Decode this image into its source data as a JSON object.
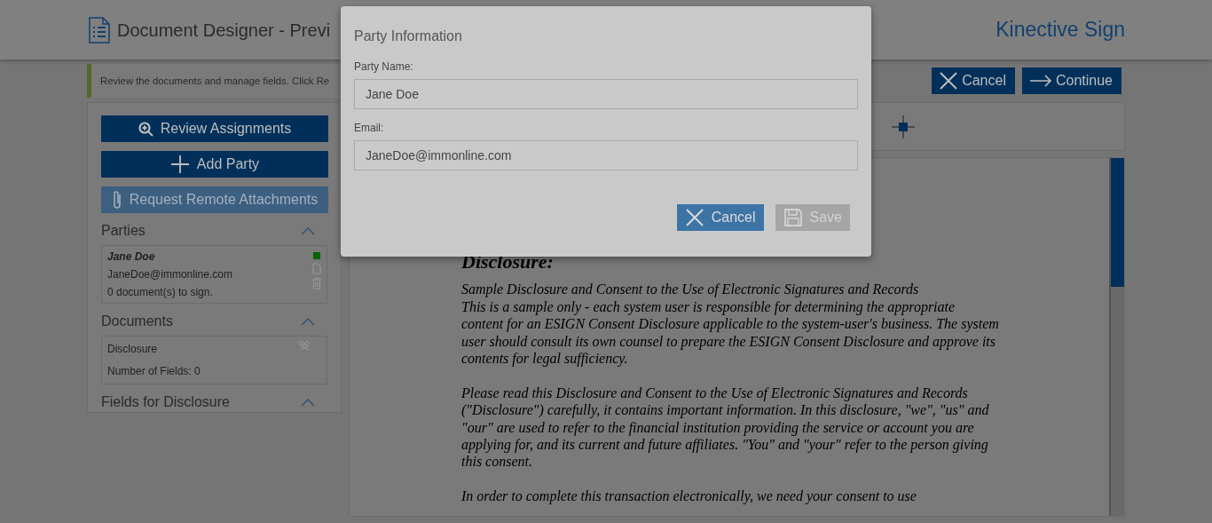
{
  "header": {
    "title": "Document Designer - Previ",
    "brand": "Kinective Sign"
  },
  "instruction": "Review the documents and manage fields. Click Re",
  "actions": [
    {
      "label": "Cancel"
    },
    {
      "label": "Continue"
    }
  ],
  "sidebar": {
    "buttons": [
      {
        "label": "Review Assignments",
        "disabled": false
      },
      {
        "label": "Add Party",
        "disabled": false
      },
      {
        "label": "Request Remote Attachments",
        "disabled": true
      }
    ],
    "sections": [
      {
        "title": "Parties",
        "expanded": true,
        "kind": "parties",
        "items": [
          {
            "name": "Jane Doe",
            "email": "JaneDoe@immonline.com",
            "note": "0 document(s) to sign.",
            "color": "#006400"
          }
        ]
      },
      {
        "title": "Documents",
        "expanded": true,
        "kind": "documents",
        "items": [
          {
            "name": "Disclosure",
            "note": "Number of Fields: 0"
          }
        ]
      },
      {
        "title": "Fields for Disclosure",
        "expanded": true,
        "kind": "fields"
      }
    ]
  },
  "document": {
    "heading": "Disclosure:",
    "paragraphs": [
      [
        "Sample Disclosure and Consent to the Use of Electronic Signatures and Records",
        "This is a sample only - each system user is responsible for determining the appropriate content for an ESIGN Consent Disclosure applicable to the system-user's business. The system user should consult its own counsel to prepare the ESIGN Consent Disclosure and approve its contents for legal sufficiency."
      ],
      [
        "Please read this Disclosure and Consent to the Use of Electronic Signatures and Records (\"Disclosure\") carefully, it contains important information. In this disclosure, \"we\", \"us\" and \"our\" are used to refer to the financial institution providing the service or account you are applying for, and its current and future affiliates. \"You\" and \"your\" refer to the person giving this consent."
      ],
      [
        "In order to complete this transaction electronically, we need your consent to use"
      ]
    ]
  },
  "dialog": {
    "title": "Party Information",
    "fields": [
      {
        "label": "Party Name:",
        "value": "Jane Doe"
      },
      {
        "label": "Email:",
        "value": "JaneDoe@immonline.com"
      }
    ],
    "buttons": [
      {
        "label": "Cancel",
        "disabled": false
      },
      {
        "label": "Save",
        "disabled": true
      }
    ]
  }
}
